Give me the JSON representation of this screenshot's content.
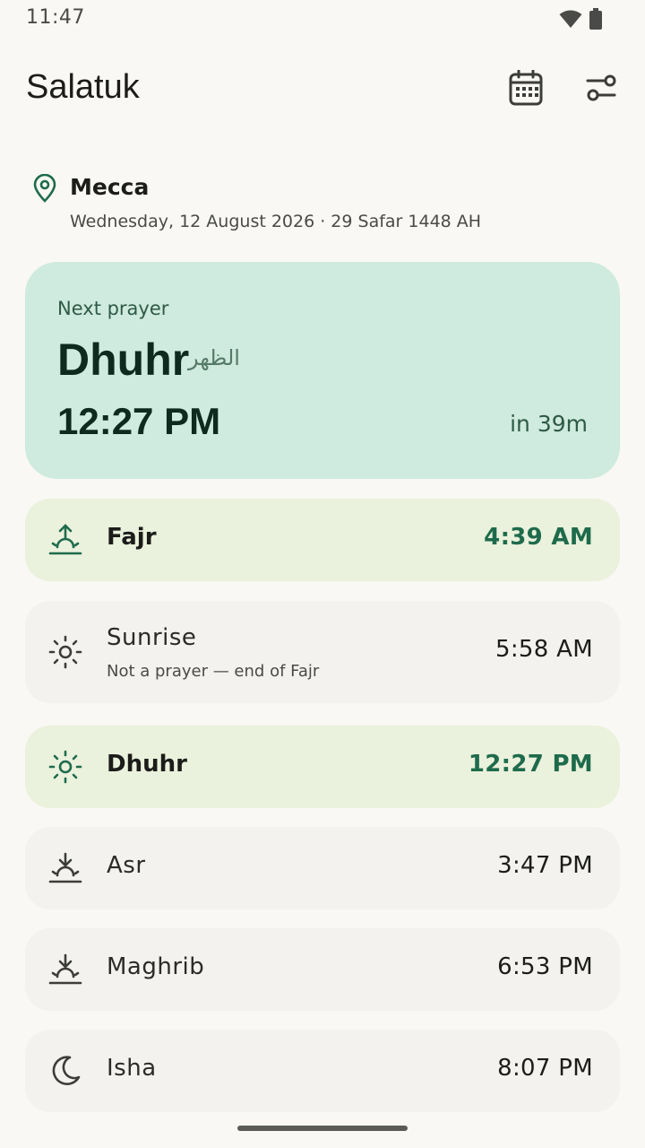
{
  "status": {
    "time": "11:47"
  },
  "app": {
    "title": "Salatuk"
  },
  "location": {
    "city": "Mecca",
    "date_line": "Wednesday, 12 August 2026  ·  29 Safar 1448 AH"
  },
  "next_prayer": {
    "label": "Next prayer",
    "name": "Dhuhr",
    "arabic": "الظهر",
    "time": "12:27 PM",
    "countdown": "in 39m"
  },
  "prayers": [
    {
      "name": "Fajr",
      "time": "4:39 AM",
      "icon": "sunrise-up-icon",
      "highlighted": true
    },
    {
      "name": "Sunrise",
      "subtitle": "Not a prayer — end of Fajr",
      "time": "5:58 AM",
      "icon": "sun-icon"
    },
    {
      "name": "Dhuhr",
      "time": "12:27 PM",
      "icon": "sun-icon",
      "highlighted": true
    },
    {
      "name": "Asr",
      "time": "3:47 PM",
      "icon": "sunset-down-icon"
    },
    {
      "name": "Maghrib",
      "time": "6:53 PM",
      "icon": "sunset-down-icon"
    },
    {
      "name": "Isha",
      "time": "8:07 PM",
      "icon": "moon-icon"
    }
  ],
  "colors": {
    "background": "#f9f8f4",
    "next_card": "#cfeade",
    "highlight_row": "#eaf1dc",
    "accent": "#1e6b4c"
  }
}
